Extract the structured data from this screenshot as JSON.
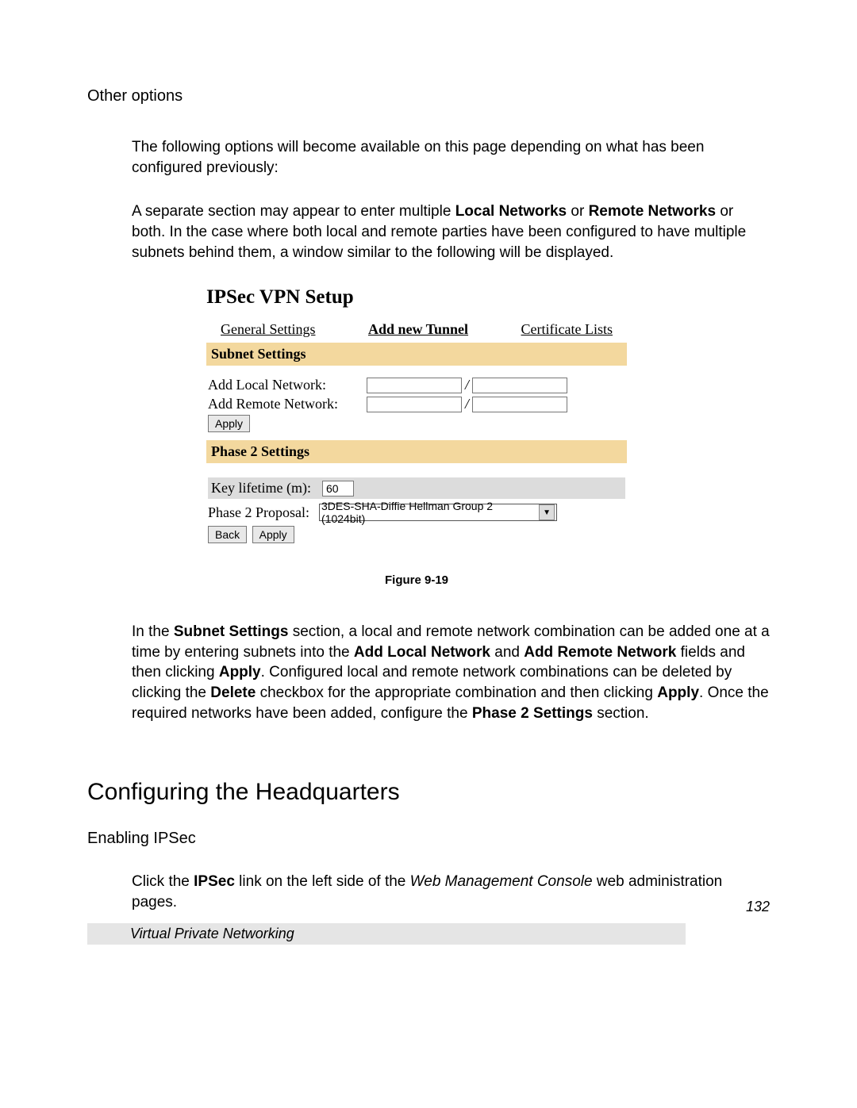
{
  "headings": {
    "other_options": "Other options",
    "configuring_hq": "Configuring the Headquarters",
    "enabling_ipsec": "Enabling IPSec"
  },
  "paragraphs": {
    "p1": "The following options will become available on this page depending on what has been configured previously:",
    "p2a": "A separate section may appear to enter multiple ",
    "p2b": "Local Networks",
    "p2c": " or ",
    "p2d": "Remote Networks",
    "p2e": " or both.  In the case where both local and remote parties have been configured to have multiple subnets behind them, a window similar to the following will be displayed.",
    "p3a": "In the ",
    "p3b": "Subnet Settings",
    "p3c": " section, a local and remote network combination can be added one at a time by entering subnets into the ",
    "p3d": "Add Local Network",
    "p3e": " and ",
    "p3f": "Add Remote Network",
    "p3g": " fields and then clicking ",
    "p3h": "Apply",
    "p3i": ".  Configured local and remote network combinations can be deleted by clicking the ",
    "p3j": "Delete",
    "p3k": " checkbox for the appropriate combination and then clicking ",
    "p3l": "Apply",
    "p3m": ".  Once the required networks have been added, configure the ",
    "p3n": "Phase 2 Settings",
    "p3o": "  section.",
    "p4a": "Click the ",
    "p4b": "IPSec",
    "p4c": " link on the left side of the ",
    "p4d": "Web Management Console",
    "p4e": " web administration pages."
  },
  "figure": {
    "title": "IPSec VPN Setup",
    "tabs": {
      "general": "General Settings",
      "add_tunnel": "Add new Tunnel",
      "cert_lists": "Certificate Lists"
    },
    "subnet_header": "Subnet Settings",
    "add_local_label": "Add Local Network:",
    "add_remote_label": "Add Remote Network:",
    "apply_btn": "Apply",
    "phase2_header": "Phase 2 Settings",
    "key_lifetime_label": "Key lifetime (m):",
    "key_lifetime_value": "60",
    "phase2_proposal_label": "Phase 2 Proposal:",
    "phase2_proposal_value": "3DES-SHA-Diffie Hellman Group 2 (1024bit)",
    "back_btn": "Back",
    "caption": "Figure 9-19"
  },
  "footer": {
    "page_number": "132",
    "title": "Virtual Private Networking"
  }
}
